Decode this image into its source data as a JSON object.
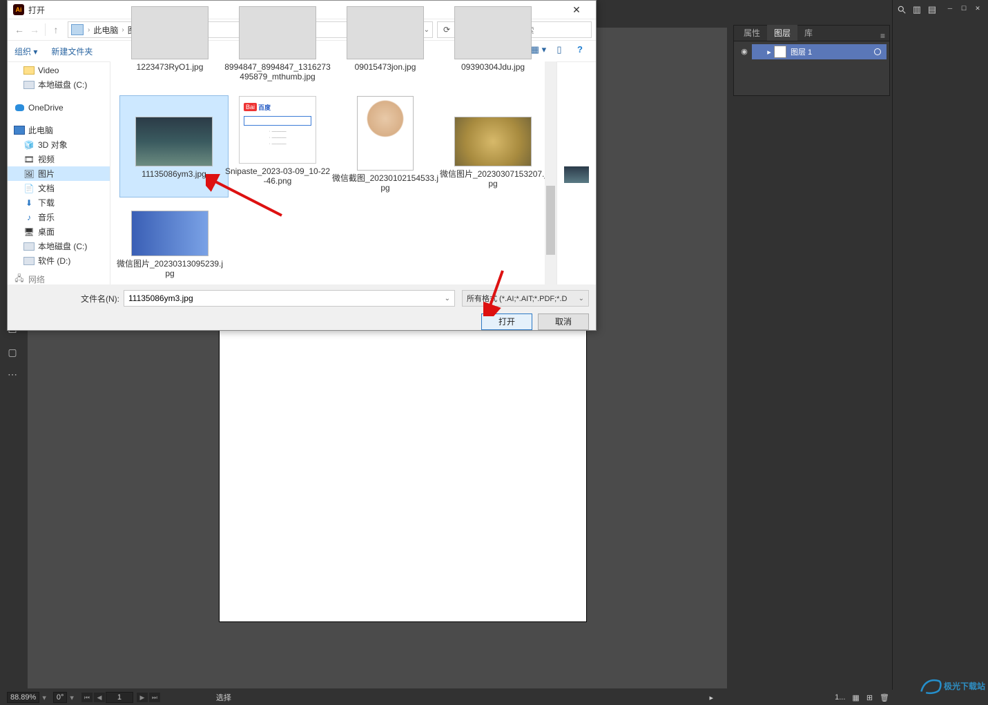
{
  "illustrator": {
    "zoom": "88.89%",
    "rotate": "0°",
    "artboard_index": "1",
    "status_mode": "选择",
    "right_zoom": "1...",
    "panel_tabs": {
      "properties": "属性",
      "layers": "图层",
      "libraries": "库"
    },
    "layer_name": "图层 1"
  },
  "dialog": {
    "title": "打开",
    "nav": {
      "crumb1": "此电脑",
      "crumb2": "图片",
      "search_placeholder": "在 图片 中搜索"
    },
    "cmdbar": {
      "organize": "组织",
      "newfolder": "新建文件夹"
    },
    "tree": {
      "video": "Video",
      "localdisk_c": "本地磁盘 (C:)",
      "onedrive": "OneDrive",
      "thispc": "此电脑",
      "objects3d": "3D 对象",
      "videos": "视频",
      "pictures": "图片",
      "documents": "文档",
      "downloads": "下载",
      "music": "音乐",
      "desktop": "桌面",
      "localdisk_c2": "本地磁盘 (C:)",
      "software_d": "软件 (D:)",
      "network": "网络"
    },
    "files_row0": {
      "f1": "1223473RyO1.jpg",
      "f2": "8994847_8994847_1316273495879_mthumb.jpg",
      "f3": "09015473jon.jpg",
      "f4": "09390304Jdu.jpg"
    },
    "files_row1": {
      "f1": "11135086ym3.jpg",
      "f2": "Snipaste_2023-03-09_10-22-46.png",
      "f3": "微信截图_20230102154533.jpg",
      "f4": "微信图片_20230307153207.jpg"
    },
    "files_row2": {
      "f1": "微信图片_20230313095239.jpg"
    },
    "filename_label": "文件名(N):",
    "filename_value": "11135086ym3.jpg",
    "filetype_value": "所有格式 (*.AI;*.AIT;*.PDF;*.D",
    "open_btn": "打开",
    "cancel_btn": "取消"
  },
  "watermark": "极光下载站"
}
